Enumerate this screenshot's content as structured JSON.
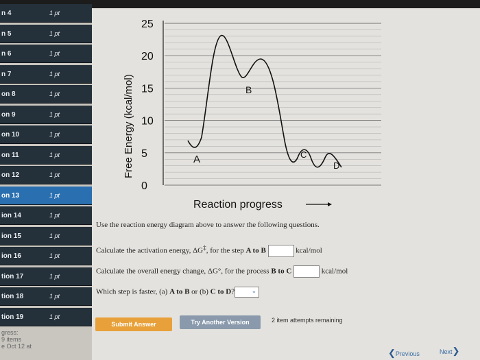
{
  "sidebar": {
    "items": [
      {
        "label": "n 4",
        "points": "1 pt"
      },
      {
        "label": "n 5",
        "points": "1 pt"
      },
      {
        "label": "n 6",
        "points": "1 pt"
      },
      {
        "label": "n 7",
        "points": "1 pt"
      },
      {
        "label": "on 8",
        "points": "1 pt"
      },
      {
        "label": "on 9",
        "points": "1 pt"
      },
      {
        "label": "on 10",
        "points": "1 pt"
      },
      {
        "label": "on 11",
        "points": "1 pt"
      },
      {
        "label": "on 12",
        "points": "1 pt"
      },
      {
        "label": "on 13",
        "points": "1 pt"
      },
      {
        "label": "ion 14",
        "points": "1 pt"
      },
      {
        "label": "ion 15",
        "points": "1 pt"
      },
      {
        "label": "ion 16",
        "points": "1 pt"
      },
      {
        "label": "tion 17",
        "points": "1 pt"
      },
      {
        "label": "tion 18",
        "points": "1 pt"
      },
      {
        "label": "tion 19",
        "points": "1 pt"
      }
    ],
    "active_index": 9,
    "progress_label": "gress:",
    "progress_items": "9 items",
    "due": "e Oct 12 at"
  },
  "diagram": {
    "ylabel": "Free Energy (kcal/mol)",
    "xlabel": "Reaction progress",
    "y_ticks": [
      "25",
      "20",
      "15",
      "10",
      "5",
      "0"
    ],
    "point_labels": [
      "A",
      "B",
      "C",
      "D"
    ]
  },
  "questions": {
    "intro": "Use the reaction energy diagram above to answer the following questions.",
    "q1_prefix": "Calculate the activation energy, ΔG",
    "q1_sup": "‡",
    "q1_mid": ", for the step ",
    "q1_step": "A to B",
    "q1_unit": "kcal/mol",
    "q2_prefix": "Calculate the overall energy change, ΔG°, for the process ",
    "q2_step": "B to C",
    "q2_unit": "kcal/mol",
    "q3_prefix": "Which step is faster, (a) ",
    "q3_a": "A to B",
    "q3_or": " or (b) ",
    "q3_b": "C to D",
    "q3_end": "?"
  },
  "actions": {
    "submit": "Submit Answer",
    "try_another": "Try Another Version",
    "attempts": "2 item attempts remaining",
    "previous": "Previous",
    "next": "Next"
  },
  "colors": {
    "submit": "#e8a13a",
    "try_another": "#8a9aac",
    "active_item": "#2a6fb0"
  }
}
